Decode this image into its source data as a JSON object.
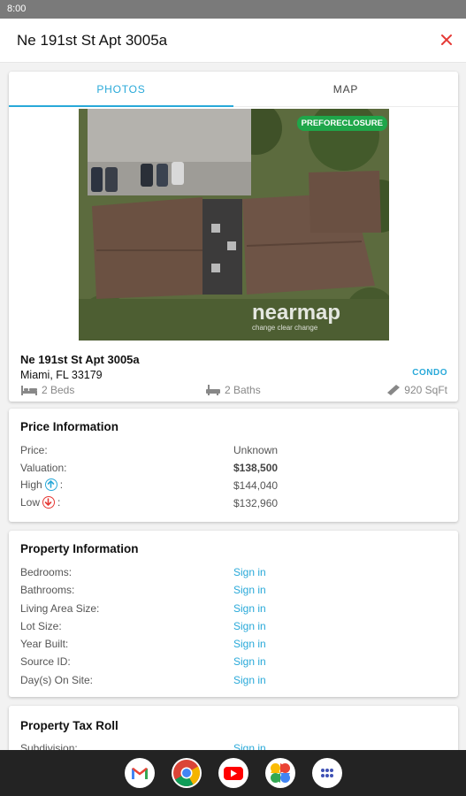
{
  "status_bar": {
    "time": "8:00"
  },
  "header": {
    "title": "Ne 191st St Apt 3005a",
    "close_icon": "close-icon"
  },
  "tabs": [
    {
      "label": "PHOTOS",
      "active": true
    },
    {
      "label": "MAP",
      "active": false
    }
  ],
  "listing": {
    "badge": "PREFORECLOSURE",
    "address_line1": "Ne 191st St Apt 3005a",
    "address_line2": "Miami, FL 33179",
    "property_type": "CONDO",
    "beds": "2 Beds",
    "baths": "2 Baths",
    "sqft": "920 SqFt",
    "watermark": "nearmap",
    "watermark_tagline": "change clear change"
  },
  "price_info": {
    "title": "Price Information",
    "rows": [
      {
        "label": "Price:",
        "value": "Unknown"
      },
      {
        "label": "Valuation:",
        "value": "$138,500"
      },
      {
        "label": "High",
        "suffix": ":",
        "value": "$144,040",
        "icon": "arrow-up-circle-icon"
      },
      {
        "label": "Low",
        "suffix": ":",
        "value": "$132,960",
        "icon": "arrow-down-circle-icon"
      }
    ]
  },
  "property_info": {
    "title": "Property Information",
    "rows": [
      {
        "label": "Bedrooms:",
        "value": "Sign in"
      },
      {
        "label": "Bathrooms:",
        "value": "Sign in"
      },
      {
        "label": "Living Area Size:",
        "value": "Sign in"
      },
      {
        "label": "Lot Size:",
        "value": "Sign in"
      },
      {
        "label": "Year Built:",
        "value": "Sign in"
      },
      {
        "label": "Source ID:",
        "value": "Sign in"
      },
      {
        "label": "Day(s) On Site:",
        "value": "Sign in"
      }
    ]
  },
  "tax_roll": {
    "title": "Property Tax Roll",
    "rows": [
      {
        "label": "Subdivision:",
        "value": "Sign in"
      }
    ]
  },
  "dock": {
    "apps": [
      "gmail-icon",
      "chrome-icon",
      "youtube-icon",
      "google-photos-icon",
      "app-drawer-icon"
    ]
  },
  "colors": {
    "accent": "#29a9d9",
    "close": "#e53935",
    "badge": "#1fa64a"
  }
}
